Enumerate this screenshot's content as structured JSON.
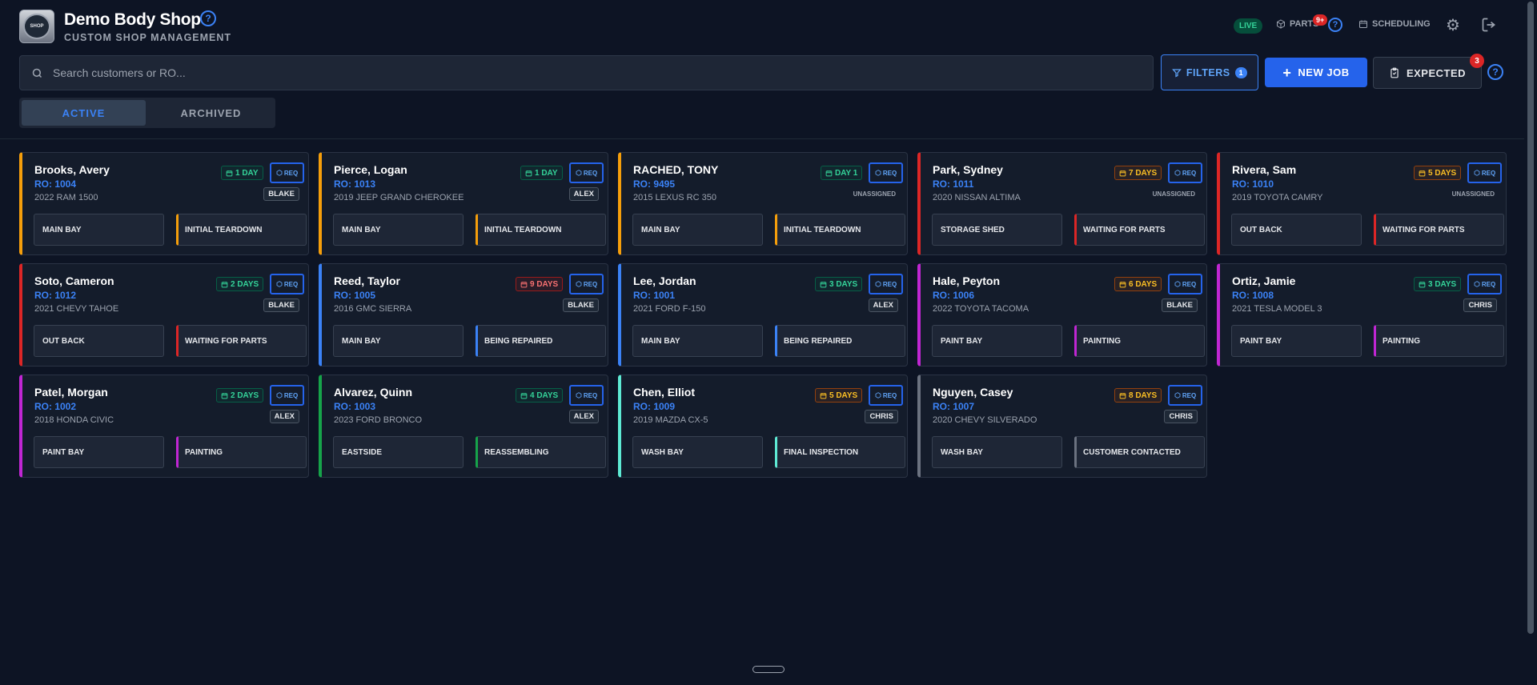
{
  "header": {
    "title": "Demo Body Shop",
    "subtitle": "CUSTOM SHOP MANAGEMENT",
    "live_label": "LIVE",
    "parts_label": "PARTS",
    "parts_badge": "9+",
    "scheduling_label": "SCHEDULING"
  },
  "toolbar": {
    "search_placeholder": "Search customers or RO...",
    "filters_label": "FILTERS",
    "filters_count": "1",
    "new_job_label": "NEW JOB",
    "expected_label": "EXPECTED",
    "expected_badge": "3"
  },
  "tabs": [
    {
      "label": "ACTIVE",
      "active": true
    },
    {
      "label": "ARCHIVED",
      "active": false
    }
  ],
  "colors": {
    "accent": "#2563eb",
    "orange": "#f59e0b",
    "red": "#dc2626",
    "blue": "#3b82f6",
    "purple": "#c026d3",
    "green": "#16a34a",
    "teal": "#5eead4",
    "gray": "#6b7280"
  },
  "req_label": "REQ",
  "jobs": [
    {
      "name": "Brooks, Avery",
      "ro": "RO: 1004",
      "vehicle": "2022 RAM 1500",
      "days": "1 DAY",
      "days_tone": "green",
      "tech": "BLAKE",
      "location": "MAIN BAY",
      "status": "INITIAL TEARDOWN",
      "color": "orange"
    },
    {
      "name": "Pierce, Logan",
      "ro": "RO: 1013",
      "vehicle": "2019 JEEP GRAND CHEROKEE",
      "days": "1 DAY",
      "days_tone": "green",
      "tech": "ALEX",
      "location": "MAIN BAY",
      "status": "INITIAL TEARDOWN",
      "color": "orange"
    },
    {
      "name": "RACHED, TONY",
      "ro": "RO: 9495",
      "vehicle": "2015 LEXUS RC 350",
      "days": "DAY 1",
      "days_tone": "green",
      "tech": "UNASSIGNED",
      "location": "MAIN BAY",
      "status": "INITIAL TEARDOWN",
      "color": "orange"
    },
    {
      "name": "Park, Sydney",
      "ro": "RO: 1011",
      "vehicle": "2020 NISSAN ALTIMA",
      "days": "7 DAYS",
      "days_tone": "orange",
      "tech": "UNASSIGNED",
      "location": "STORAGE SHED",
      "status": "WAITING FOR PARTS",
      "color": "red"
    },
    {
      "name": "Rivera, Sam",
      "ro": "RO: 1010",
      "vehicle": "2019 TOYOTA CAMRY",
      "days": "5 DAYS",
      "days_tone": "orange",
      "tech": "UNASSIGNED",
      "location": "OUT BACK",
      "status": "WAITING FOR PARTS",
      "color": "red"
    },
    {
      "name": "Soto, Cameron",
      "ro": "RO: 1012",
      "vehicle": "2021 CHEVY TAHOE",
      "days": "2 DAYS",
      "days_tone": "green",
      "tech": "BLAKE",
      "location": "OUT BACK",
      "status": "WAITING FOR PARTS",
      "color": "red"
    },
    {
      "name": "Reed, Taylor",
      "ro": "RO: 1005",
      "vehicle": "2016 GMC SIERRA",
      "days": "9 DAYS",
      "days_tone": "red",
      "tech": "BLAKE",
      "location": "MAIN BAY",
      "status": "BEING REPAIRED",
      "color": "blue"
    },
    {
      "name": "Lee, Jordan",
      "ro": "RO: 1001",
      "vehicle": "2021 FORD F-150",
      "days": "3 DAYS",
      "days_tone": "green",
      "tech": "ALEX",
      "location": "MAIN BAY",
      "status": "BEING REPAIRED",
      "color": "blue"
    },
    {
      "name": "Hale, Peyton",
      "ro": "RO: 1006",
      "vehicle": "2022 TOYOTA TACOMA",
      "days": "6 DAYS",
      "days_tone": "orange",
      "tech": "BLAKE",
      "location": "PAINT BAY",
      "status": "PAINTING",
      "color": "purple"
    },
    {
      "name": "Ortiz, Jamie",
      "ro": "RO: 1008",
      "vehicle": "2021 TESLA MODEL 3",
      "days": "3 DAYS",
      "days_tone": "green",
      "tech": "CHRIS",
      "location": "PAINT BAY",
      "status": "PAINTING",
      "color": "purple"
    },
    {
      "name": "Patel, Morgan",
      "ro": "RO: 1002",
      "vehicle": "2018 HONDA CIVIC",
      "days": "2 DAYS",
      "days_tone": "green",
      "tech": "ALEX",
      "location": "PAINT BAY",
      "status": "PAINTING",
      "color": "purple"
    },
    {
      "name": "Alvarez, Quinn",
      "ro": "RO: 1003",
      "vehicle": "2023 FORD BRONCO",
      "days": "4 DAYS",
      "days_tone": "green",
      "tech": "ALEX",
      "location": "EASTSIDE",
      "status": "REASSEMBLING",
      "color": "green"
    },
    {
      "name": "Chen, Elliot",
      "ro": "RO: 1009",
      "vehicle": "2019 MAZDA CX-5",
      "days": "5 DAYS",
      "days_tone": "orange",
      "tech": "CHRIS",
      "location": "WASH BAY",
      "status": "FINAL INSPECTION",
      "color": "teal"
    },
    {
      "name": "Nguyen, Casey",
      "ro": "RO: 1007",
      "vehicle": "2020 CHEVY SILVERADO",
      "days": "8 DAYS",
      "days_tone": "orange",
      "tech": "CHRIS",
      "location": "WASH BAY",
      "status": "CUSTOMER CONTACTED",
      "color": "gray"
    }
  ]
}
